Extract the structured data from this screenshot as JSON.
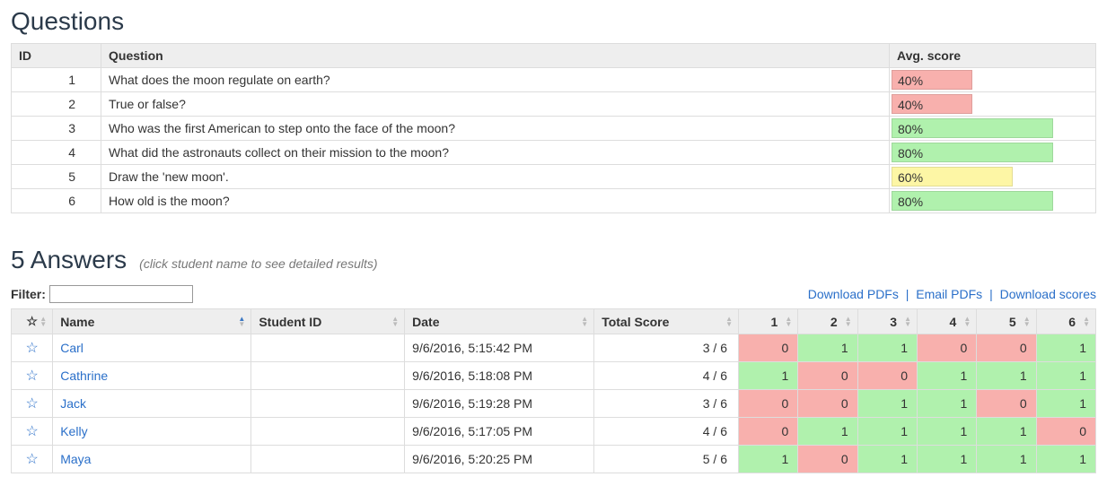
{
  "questions": {
    "heading": "Questions",
    "columns": {
      "id": "ID",
      "question": "Question",
      "avg": "Avg. score"
    },
    "rows": [
      {
        "id": "1",
        "text": "What does the moon regulate on earth?",
        "score_label": "40%",
        "score_pct": 40,
        "color": "red"
      },
      {
        "id": "2",
        "text": "True or false?",
        "score_label": "40%",
        "score_pct": 40,
        "color": "red"
      },
      {
        "id": "3",
        "text": "Who was the first American to step onto the face of the moon?",
        "score_label": "80%",
        "score_pct": 80,
        "color": "green"
      },
      {
        "id": "4",
        "text": "What did the astronauts collect on their mission to the moon?",
        "score_label": "80%",
        "score_pct": 80,
        "color": "green"
      },
      {
        "id": "5",
        "text": "Draw the 'new moon'.",
        "score_label": "60%",
        "score_pct": 60,
        "color": "yellow"
      },
      {
        "id": "6",
        "text": "How old is the moon?",
        "score_label": "80%",
        "score_pct": 80,
        "color": "green"
      }
    ]
  },
  "answers": {
    "heading": "5 Answers",
    "hint": "(click student name to see detailed results)",
    "filter_label": "Filter:",
    "filter_value": "",
    "links": {
      "download_pdfs": "Download PDFs",
      "email_pdfs": "Email PDFs",
      "download_scores": "Download scores"
    },
    "columns": {
      "star": "☆",
      "name": "Name",
      "student_id": "Student ID",
      "date": "Date",
      "total": "Total Score",
      "q": [
        "1",
        "2",
        "3",
        "4",
        "5",
        "6"
      ]
    },
    "sort": {
      "column": "name",
      "dir": "asc"
    },
    "rows": [
      {
        "name": "Carl",
        "student_id": "",
        "date": "9/6/2016, 5:15:42 PM",
        "total": "3 / 6",
        "scores": [
          0,
          1,
          1,
          0,
          0,
          1
        ]
      },
      {
        "name": "Cathrine",
        "student_id": "",
        "date": "9/6/2016, 5:18:08 PM",
        "total": "4 / 6",
        "scores": [
          1,
          0,
          0,
          1,
          1,
          1
        ]
      },
      {
        "name": "Jack",
        "student_id": "",
        "date": "9/6/2016, 5:19:28 PM",
        "total": "3 / 6",
        "scores": [
          0,
          0,
          1,
          1,
          0,
          1
        ]
      },
      {
        "name": "Kelly",
        "student_id": "",
        "date": "9/6/2016, 5:17:05 PM",
        "total": "4 / 6",
        "scores": [
          0,
          1,
          1,
          1,
          1,
          0
        ]
      },
      {
        "name": "Maya",
        "student_id": "",
        "date": "9/6/2016, 5:20:25 PM",
        "total": "5 / 6",
        "scores": [
          1,
          0,
          1,
          1,
          1,
          1
        ]
      }
    ]
  }
}
